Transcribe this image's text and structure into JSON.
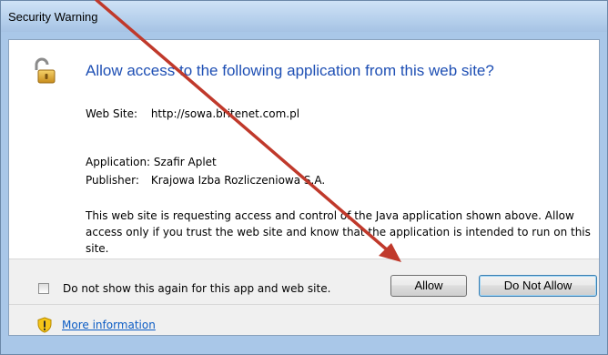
{
  "window": {
    "title": "Security Warning"
  },
  "dialog": {
    "headline": "Allow access to the following application from this web site?",
    "web_site_label": "Web Site:",
    "web_site_value": "http://sowa.britenet.com.pl",
    "application_label": "Application:",
    "application_value": "Szafir Aplet",
    "publisher_label": "Publisher:",
    "publisher_value": "Krajowa Izba Rozliczeniowa S.A.",
    "description": "This web site is requesting access and control of the Java application shown above. Allow access only if you trust the web site and know that the application is intended to run on this site.",
    "checkbox_label": "Do not show this again for this app and web site.",
    "checkbox_checked": false,
    "allow_label": "Allow",
    "deny_label": "Do Not Allow",
    "more_info_label": "More information"
  },
  "icons": {
    "header": "unlocked-padlock-icon",
    "footer": "warning-shield-icon"
  },
  "colors": {
    "headline": "#1e4fb4",
    "link": "#0a5bc4",
    "title_bar": "#b6d0ec",
    "annotation_arrow": "#c0392b"
  }
}
